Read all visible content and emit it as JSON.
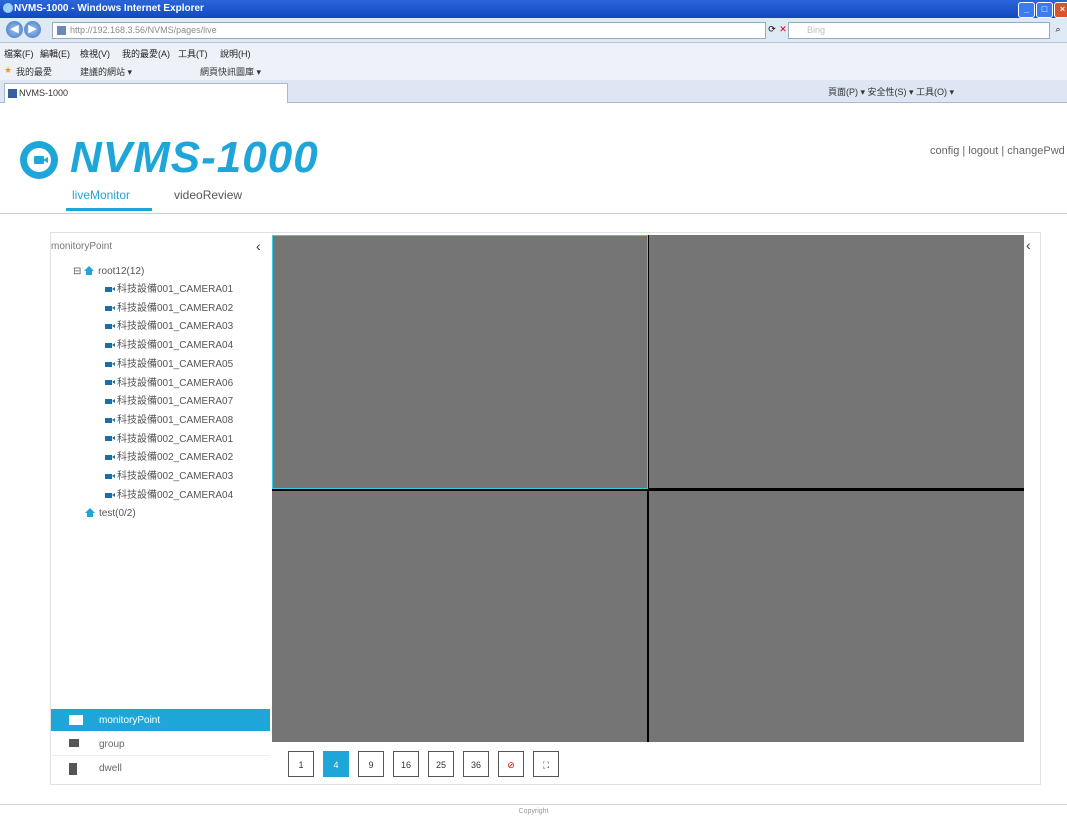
{
  "browser": {
    "title": "NVMS-1000 - Windows Internet Explorer",
    "address": "http://192.168.3.56/NVMS/pages/live",
    "search_placeholder": "Bing",
    "menu": [
      "檔案(F)",
      "編輯(E)",
      "檢視(V)",
      "我的最愛(A)",
      "工具(T)",
      "說明(H)"
    ],
    "favorites_label": "我的最愛",
    "fav_items": [
      "建議的網站 ▾",
      "網頁快訊圖庫 ▾"
    ],
    "tab_title": "NVMS-1000",
    "tools": "頁面(P) ▾  安全性(S) ▾  工具(O) ▾"
  },
  "app": {
    "logo_text": "NVMS-1000",
    "toplinks": "config | logout | changePwd",
    "tabs": [
      {
        "label": "liveMonitor",
        "active": true
      },
      {
        "label": "videoReview",
        "active": false
      }
    ]
  },
  "sidebar": {
    "title": "monitoryPoint",
    "groups": [
      {
        "label": "root12(12)",
        "expanded": true,
        "cameras": [
          "科技設備001_CAMERA01",
          "科技設備001_CAMERA02",
          "科技設備001_CAMERA03",
          "科技設備001_CAMERA04",
          "科技設備001_CAMERA05",
          "科技設備001_CAMERA06",
          "科技設備001_CAMERA07",
          "科技設備001_CAMERA08",
          "科技設備002_CAMERA01",
          "科技設備002_CAMERA02",
          "科技設備002_CAMERA03",
          "科技設備002_CAMERA04"
        ]
      },
      {
        "label": "test(0/2)",
        "expanded": false,
        "cameras": []
      }
    ],
    "bottom_tabs": [
      {
        "label": "monitoryPoint",
        "active": true,
        "icon": "camera-icon"
      },
      {
        "label": "group",
        "active": false,
        "icon": "group-icon"
      },
      {
        "label": "dwell",
        "active": false,
        "icon": "building-icon"
      }
    ]
  },
  "layout_buttons": [
    {
      "label": "1",
      "active": false
    },
    {
      "label": "4",
      "active": true
    },
    {
      "label": "9",
      "active": false
    },
    {
      "label": "16",
      "active": false
    },
    {
      "label": "25",
      "active": false
    },
    {
      "label": "36",
      "active": false
    },
    {
      "label": "stop-all",
      "active": false
    },
    {
      "label": "fullscreen",
      "active": false
    }
  ],
  "footer": "Copyright",
  "colors": {
    "accent": "#1fa6d9",
    "cell": "#757575",
    "selected_border": "#2fd0e8"
  }
}
